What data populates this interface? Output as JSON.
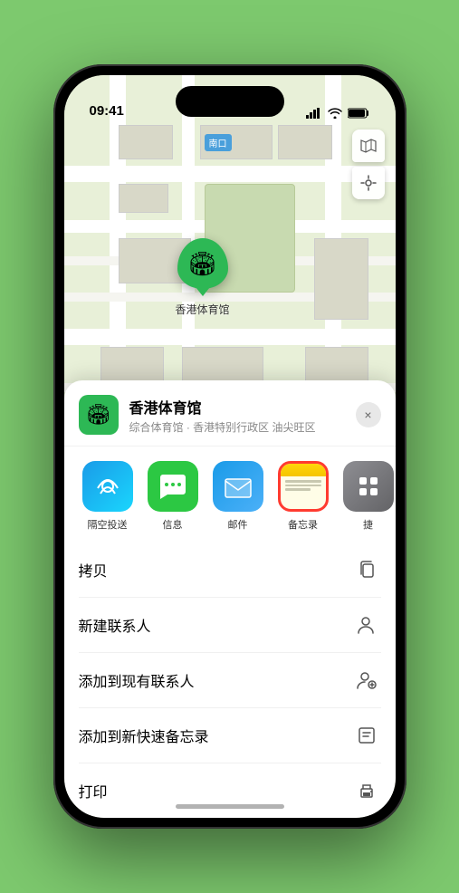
{
  "statusBar": {
    "time": "09:41",
    "signal": "signal-icon",
    "wifi": "wifi-icon",
    "battery": "battery-icon"
  },
  "map": {
    "label": "南口",
    "markerLabel": "香港体育馆"
  },
  "venueSheet": {
    "name": "香港体育馆",
    "subtitle": "综合体育馆 · 香港特别行政区 油尖旺区",
    "closeLabel": "×"
  },
  "shareApps": [
    {
      "id": "airdrop",
      "label": "隔空投送",
      "icon": "airdrop"
    },
    {
      "id": "messages",
      "label": "信息",
      "icon": "messages"
    },
    {
      "id": "mail",
      "label": "邮件",
      "icon": "mail"
    },
    {
      "id": "notes",
      "label": "备忘录",
      "icon": "notes"
    },
    {
      "id": "more",
      "label": "捷",
      "icon": "more"
    }
  ],
  "actions": [
    {
      "label": "拷贝",
      "icon": "copy"
    },
    {
      "label": "新建联系人",
      "icon": "person-add"
    },
    {
      "label": "添加到现有联系人",
      "icon": "person-plus"
    },
    {
      "label": "添加到新快速备忘录",
      "icon": "note"
    },
    {
      "label": "打印",
      "icon": "print"
    }
  ]
}
